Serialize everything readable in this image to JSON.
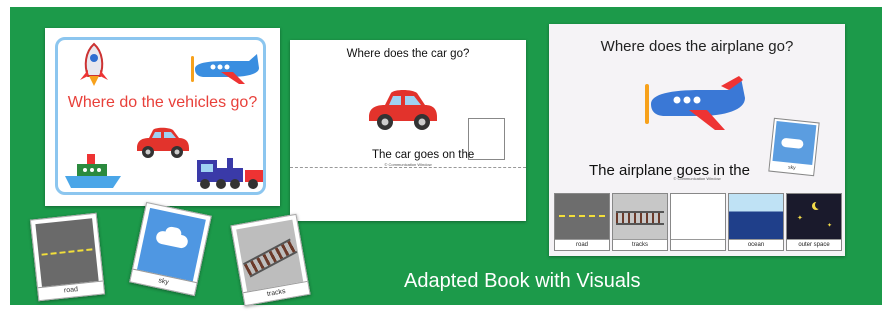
{
  "cover": {
    "title": "Where do the vehicles go?"
  },
  "car_page": {
    "question": "Where does the car go?",
    "sentence": "The car goes on the",
    "copyright": "© Communication Window"
  },
  "airplane_page": {
    "question": "Where does the airplane go?",
    "sentence": "The airplane goes in the",
    "copyright": "© Communication Window",
    "answer_label": "sky",
    "strip": [
      {
        "label": "road",
        "icon": "road-icon"
      },
      {
        "label": "tracks",
        "icon": "tracks-icon"
      },
      {
        "label": "",
        "icon": "blank-card"
      },
      {
        "label": "ocean",
        "icon": "ocean-icon"
      },
      {
        "label": "outer space",
        "icon": "outer-space-icon"
      }
    ]
  },
  "loose_cards": {
    "road": "road",
    "sky": "sky",
    "tracks": "tracks"
  },
  "caption": "Adapted Book with Visuals",
  "colors": {
    "background_green": "#1c9a4a",
    "title_red": "#e8403a",
    "frame_blue": "#8cc6ef"
  }
}
